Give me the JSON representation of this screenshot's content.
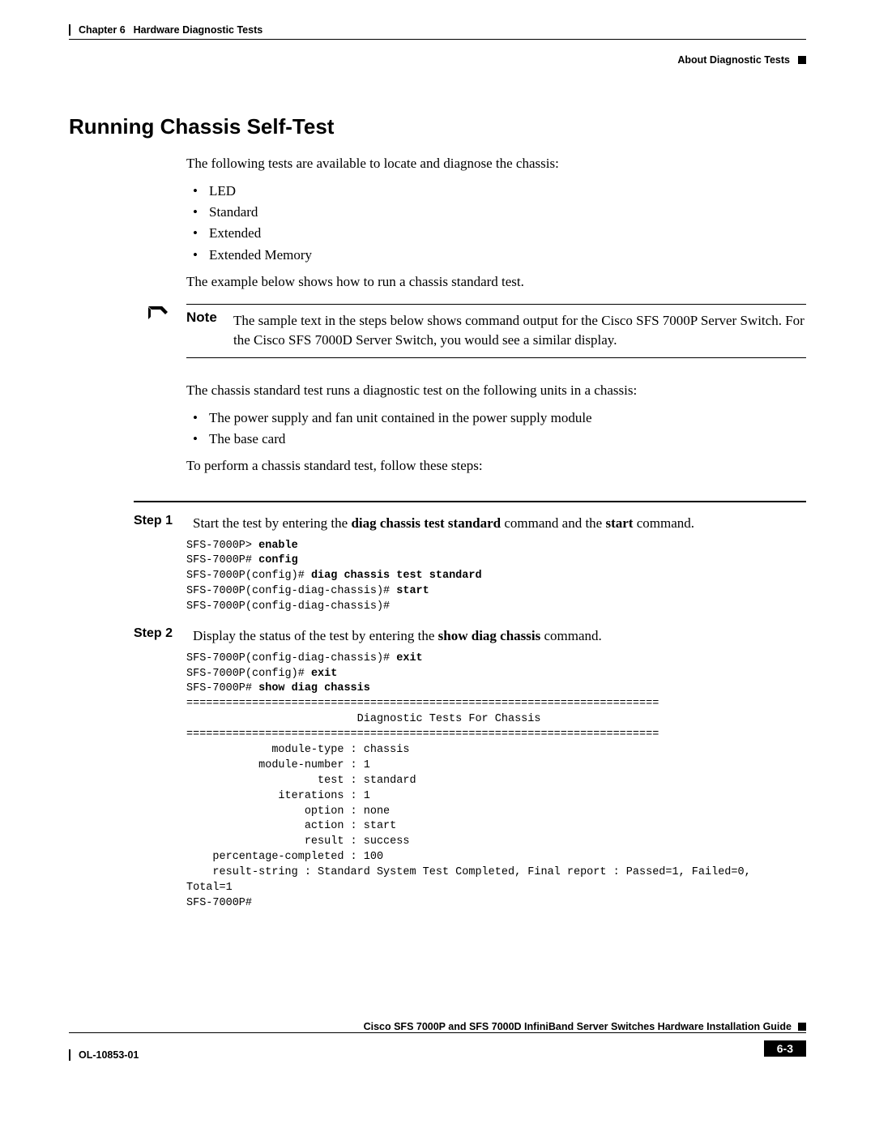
{
  "header": {
    "chapter_label": "Chapter 6",
    "chapter_title": "Hardware Diagnostic Tests",
    "section_label": "About Diagnostic Tests"
  },
  "title": "Running Chassis Self-Test",
  "intro": "The following tests are available to locate and diagnose the chassis:",
  "tests": [
    "LED",
    "Standard",
    "Extended",
    "Extended Memory"
  ],
  "example_line": "The example below shows how to run a chassis standard test.",
  "note": {
    "label": "Note",
    "text": "The sample text in the steps below shows command output for the Cisco SFS 7000P Server Switch. For the Cisco SFS 7000D Server Switch, you would see a similar display."
  },
  "diag_line": "The chassis standard test runs a diagnostic test on the following units in a chassis:",
  "units": [
    "The power supply and fan unit contained in the power supply module",
    "The base card"
  ],
  "perform_line": "To perform a chassis standard test, follow these steps:",
  "steps": {
    "s1": {
      "label": "Step 1",
      "pre": "Start the test by entering the ",
      "bold1": "diag chassis test standard",
      "mid": " command and the ",
      "bold2": "start",
      "post": " command."
    },
    "s2": {
      "label": "Step 2",
      "pre": "Display the status of the test by entering the ",
      "bold1": "show diag chassis",
      "post": " command."
    }
  },
  "code1": {
    "l1a": "SFS-7000P> ",
    "l1b": "enable",
    "l2a": "SFS-7000P# ",
    "l2b": "config",
    "l3a": "SFS-7000P(config)# ",
    "l3b": "diag chassis test standard",
    "l4a": "SFS-7000P(config-diag-chassis)# ",
    "l4b": "start",
    "l5": "SFS-7000P(config-diag-chassis)# "
  },
  "code2": {
    "l1a": "SFS-7000P(config-diag-chassis)# ",
    "l1b": "exit",
    "l2a": "SFS-7000P(config)# ",
    "l2b": "exit",
    "l3a": "SFS-7000P# ",
    "l3b": "show diag chassis",
    "sep": "========================================================================",
    "title": "                          Diagnostic Tests For Chassis",
    "r1": "             module-type : chassis",
    "r2": "           module-number : 1",
    "r3": "                    test : standard",
    "r4": "              iterations : 1",
    "r5": "                  option : none",
    "r6": "                  action : start",
    "r7": "                  result : success",
    "r8": "    percentage-completed : 100",
    "r9": "    result-string : Standard System Test Completed, Final report : Passed=1, Failed=0, ",
    "r10": "Total=1",
    "r11": "SFS-7000P#"
  },
  "footer": {
    "guide": "Cisco SFS 7000P and SFS 7000D InfiniBand Server Switches Hardware Installation Guide",
    "docnum": "OL-10853-01",
    "page": "6-3"
  }
}
